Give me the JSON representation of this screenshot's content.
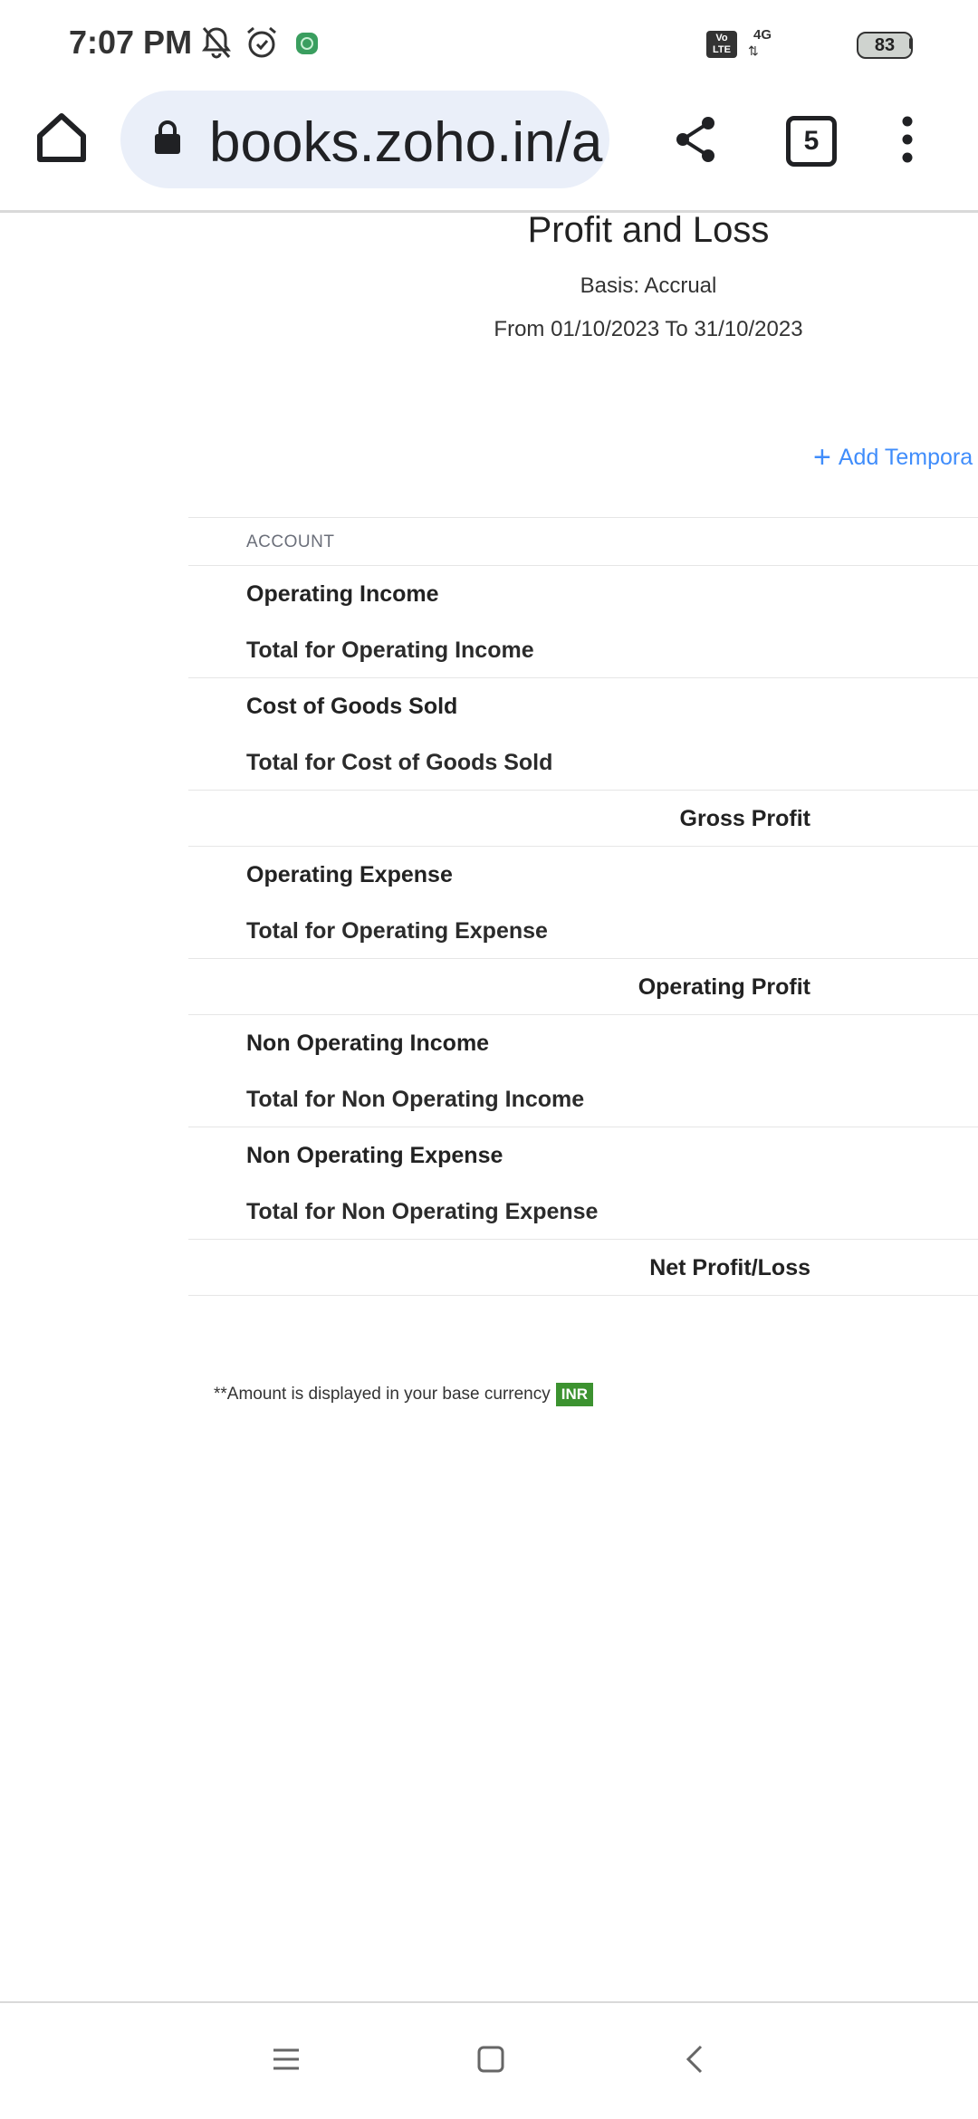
{
  "status_bar": {
    "time": "7:07 PM",
    "icons": [
      "bell-muted-icon",
      "alarm-icon",
      "app-notification-icon"
    ],
    "volte_label": "Vo LTE",
    "network": "4G",
    "battery": "83"
  },
  "browser": {
    "url": "books.zoho.in/a",
    "tab_count": "5"
  },
  "report": {
    "title": "Profit and Loss",
    "basis": "Basis: Accrual",
    "range": "From 01/10/2023 To 31/10/2023",
    "add_temp_label": "Add Tempora",
    "column_header": "ACCOUNT",
    "rows": [
      {
        "label": "Operating Income",
        "kind": "section"
      },
      {
        "label": "Total for Operating Income",
        "kind": "total"
      },
      {
        "label": "Cost of Goods Sold",
        "kind": "section"
      },
      {
        "label": "Total for Cost of Goods Sold",
        "kind": "total"
      },
      {
        "label": "Gross Profit",
        "kind": "summary"
      },
      {
        "label": "Operating Expense",
        "kind": "section"
      },
      {
        "label": "Total for Operating Expense",
        "kind": "total"
      },
      {
        "label": "Operating Profit",
        "kind": "summary"
      },
      {
        "label": "Non Operating Income",
        "kind": "section"
      },
      {
        "label": "Total for Non Operating Income",
        "kind": "total"
      },
      {
        "label": "Non Operating Expense",
        "kind": "section"
      },
      {
        "label": "Total for Non Operating Expense",
        "kind": "total"
      },
      {
        "label": "Net Profit/Loss",
        "kind": "summary"
      }
    ],
    "footnote": "**Amount is displayed in your base currency",
    "currency": "INR"
  },
  "colors": {
    "link": "#408dfb",
    "currency_badge": "#3c9230",
    "url_bar": "#eaeff9"
  }
}
